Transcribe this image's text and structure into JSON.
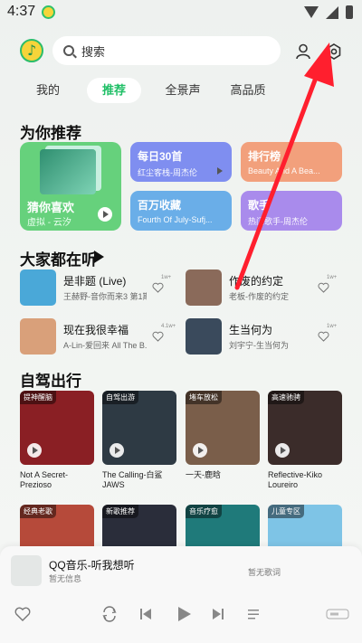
{
  "status": {
    "time": "4:37"
  },
  "search": {
    "placeholder": "搜索"
  },
  "tabs": [
    {
      "label": "我的",
      "active": false
    },
    {
      "label": "推荐",
      "active": true
    },
    {
      "label": "全景声",
      "active": false
    },
    {
      "label": "高品质",
      "active": false
    }
  ],
  "recommend": {
    "title": "为你推荐",
    "big_card": {
      "title": "猜你喜欢",
      "subtitle": "虚拟 - 云汐",
      "color": "#66d17c"
    },
    "cards": [
      {
        "title": "每日30首",
        "subtitle": "红尘客栈-周杰伦",
        "color": "#7f8ef0"
      },
      {
        "title": "排行榜",
        "subtitle": "Beauty And A Bea...",
        "color": "#f2a07c"
      },
      {
        "title": "百万收藏",
        "subtitle": "Fourth Of July-Sufj...",
        "color": "#6aaee8"
      },
      {
        "title": "歌手",
        "subtitle": "热门歌手-周杰伦",
        "color": "#a98bec"
      }
    ]
  },
  "listening": {
    "title": "大家都在听",
    "songs": [
      {
        "title": "是非题 (Live)",
        "subtitle": "王赫野-音你而来3 第1期",
        "likes": "1w+",
        "color": "#4aa8d8"
      },
      {
        "title": "作废的约定",
        "subtitle": "老板-作废的约定",
        "likes": "1w+",
        "color": "#8a6a5a"
      },
      {
        "title": "现在我很幸福",
        "subtitle": "A-Lin-爱回来 All The B...",
        "likes": "4.1w+",
        "color": "#d9a07a"
      },
      {
        "title": "生当何为",
        "subtitle": "刘宇宁-生当何为",
        "likes": "1w+",
        "color": "#3a4a5c"
      }
    ]
  },
  "drive": {
    "title": "自驾出行",
    "cards": [
      {
        "tag": "提神醒脑",
        "label": "Not A Secret-Prezioso",
        "color": "#8a1f24"
      },
      {
        "tag": "自驾出游",
        "label": "The Calling-白鲨JAWS",
        "color": "#2e3a44"
      },
      {
        "tag": "堵车放松",
        "label": "一天-鹿晗",
        "color": "#7a5e4a"
      },
      {
        "tag": "高速驰骋",
        "label": "Reflective-Kiko Loureiro",
        "color": "#3b2c2a"
      }
    ],
    "row2_tags": [
      {
        "tag": "经典老歌",
        "color": "#b64a3a"
      },
      {
        "tag": "新歌推荐",
        "color": "#2a2d3a"
      },
      {
        "tag": "音乐疗愈",
        "color": "#1f7a7a"
      },
      {
        "tag": "儿童专区",
        "color": "#7ec4e6"
      }
    ]
  },
  "player": {
    "title": "QQ音乐-听我想听",
    "subtitle": "暂无信息",
    "lyric": "暂无歌词"
  },
  "annotation": {
    "arrow_color": "#ff1f2e"
  }
}
